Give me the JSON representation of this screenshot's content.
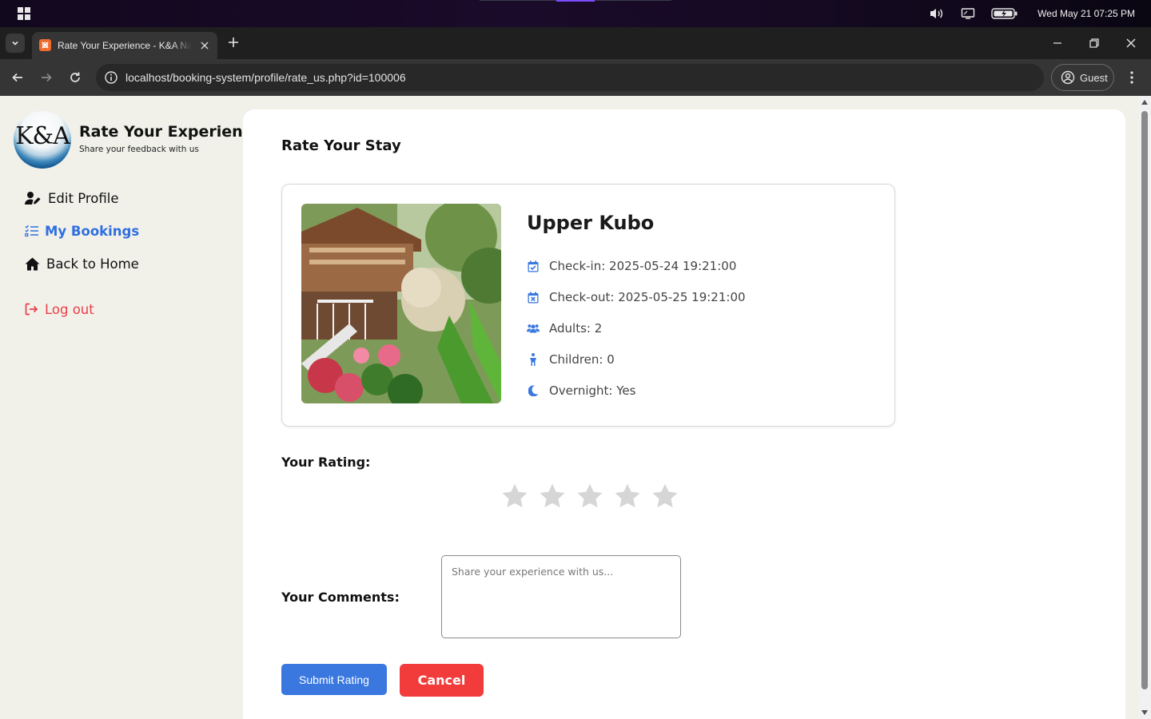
{
  "os": {
    "clock": "Wed May 21  07:25 PM",
    "icons": [
      "windows-start-icon",
      "volume-icon",
      "display-icon",
      "battery-charging-icon"
    ]
  },
  "browser": {
    "tab_title": "Rate Your Experience - K&A Natural Spring Resort",
    "url": "localhost/booking-system/profile/rate_us.php?id=100006",
    "profile_label": "Guest",
    "colors": {
      "tabstrip": "#1f1f1f",
      "toolbar": "#353535",
      "favicon": "#ef6c2f"
    }
  },
  "sidebar": {
    "logo_text": "K&A",
    "title": "Rate Your Experience",
    "subtitle": "Share your feedback with us",
    "items": [
      {
        "label": "Edit Profile",
        "icon": "user-edit-icon",
        "active": false
      },
      {
        "label": "My Bookings",
        "icon": "list-check-icon",
        "active": true
      },
      {
        "label": "Back to Home",
        "icon": "home-icon",
        "active": false
      }
    ],
    "logout_label": "Log out",
    "colors": {
      "active": "#2f6fe0",
      "logout": "#ea3e48",
      "background": "#f1f1ea"
    }
  },
  "main": {
    "title": "Rate Your Stay",
    "booking": {
      "room_name": "Upper Kubo",
      "check_in": "Check-in: 2025-05-24 19:21:00",
      "check_out": "Check-out: 2025-05-25 19:21:00",
      "adults": "Adults: 2",
      "children": "Children: 0",
      "overnight": "Overnight: Yes",
      "icon_color": "#3a78e0"
    },
    "rating": {
      "label": "Your Rating:",
      "max": 5,
      "value": 0,
      "star_color": "#d6d6d6"
    },
    "comments": {
      "label": "Your Comments:",
      "placeholder": "Share your experience with us...",
      "value": ""
    },
    "buttons": {
      "submit": "Submit Rating",
      "cancel": "Cancel",
      "submit_color": "#3a78e0",
      "cancel_color": "#f23c3c"
    }
  }
}
